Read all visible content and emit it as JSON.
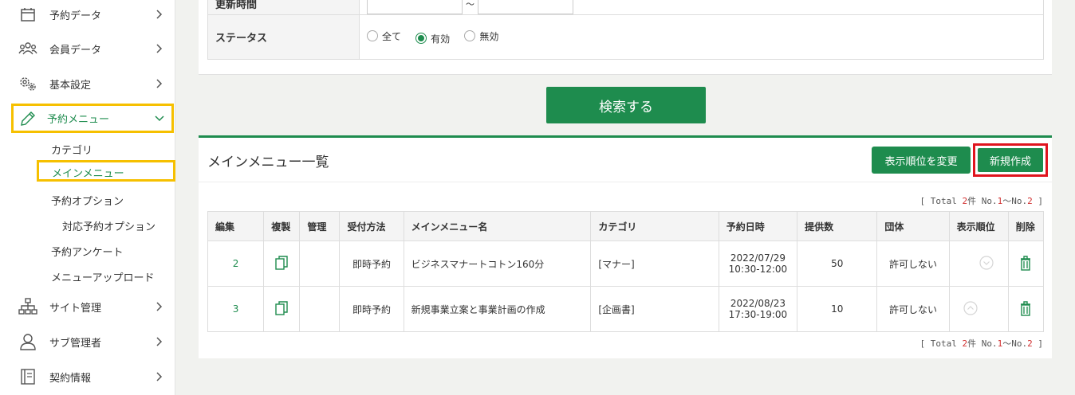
{
  "sidebar": {
    "items": [
      {
        "label": "予約データ",
        "icon": "calendar-icon"
      },
      {
        "label": "会員データ",
        "icon": "people-icon"
      },
      {
        "label": "基本設定",
        "icon": "gears-icon"
      },
      {
        "label": "予約メニュー",
        "icon": "pencil-icon",
        "active": true
      },
      {
        "label": "サイト管理",
        "icon": "sitemap-icon"
      },
      {
        "label": "サブ管理者",
        "icon": "user-icon"
      },
      {
        "label": "契約情報",
        "icon": "book-icon"
      }
    ],
    "subitems": [
      "カテゴリ",
      "メインメニュー",
      "予約オプション",
      "対応予約オプション",
      "予約アンケート",
      "メニューアップロード"
    ]
  },
  "search": {
    "updated_label": "更新時間",
    "updated_separator": "〜",
    "status_label": "ステータス",
    "status_options": [
      "全て",
      "有効",
      "無効"
    ],
    "status_selected": "有効",
    "submit_label": "検索する"
  },
  "list": {
    "title": "メインメニュー一覧",
    "change_order_label": "表示順位を変更",
    "new_label": "新規作成",
    "total": {
      "prefix": "[ Total ",
      "count": "2",
      "mid": "件 No.",
      "from": "1",
      "sep": "〜No.",
      "to": "2",
      "suffix": " ]"
    },
    "columns": [
      "編集",
      "複製",
      "管理",
      "受付方法",
      "メインメニュー名",
      "カテゴリ",
      "予約日時",
      "提供数",
      "団体",
      "表示順位",
      "削除"
    ],
    "rows": [
      {
        "edit": "2",
        "method": "即時予約",
        "name": "ビジネスマナートコトン160分",
        "category": "[マナー]",
        "date": "2022/07/29",
        "time": "10:30-12:00",
        "count": "50",
        "group": "許可しない",
        "order_icon": "chevron-down-circle-icon"
      },
      {
        "edit": "3",
        "method": "即時予約",
        "name": "新規事業立案と事業計画の作成",
        "category": "[企画書]",
        "date": "2022/08/23",
        "time": "17:30-19:00",
        "count": "10",
        "group": "許可しない",
        "order_icon": "chevron-up-circle-icon"
      }
    ]
  },
  "colors": {
    "accent": "#1e8c4e",
    "highlight": "#f6c000",
    "alert": "#e0141e"
  }
}
